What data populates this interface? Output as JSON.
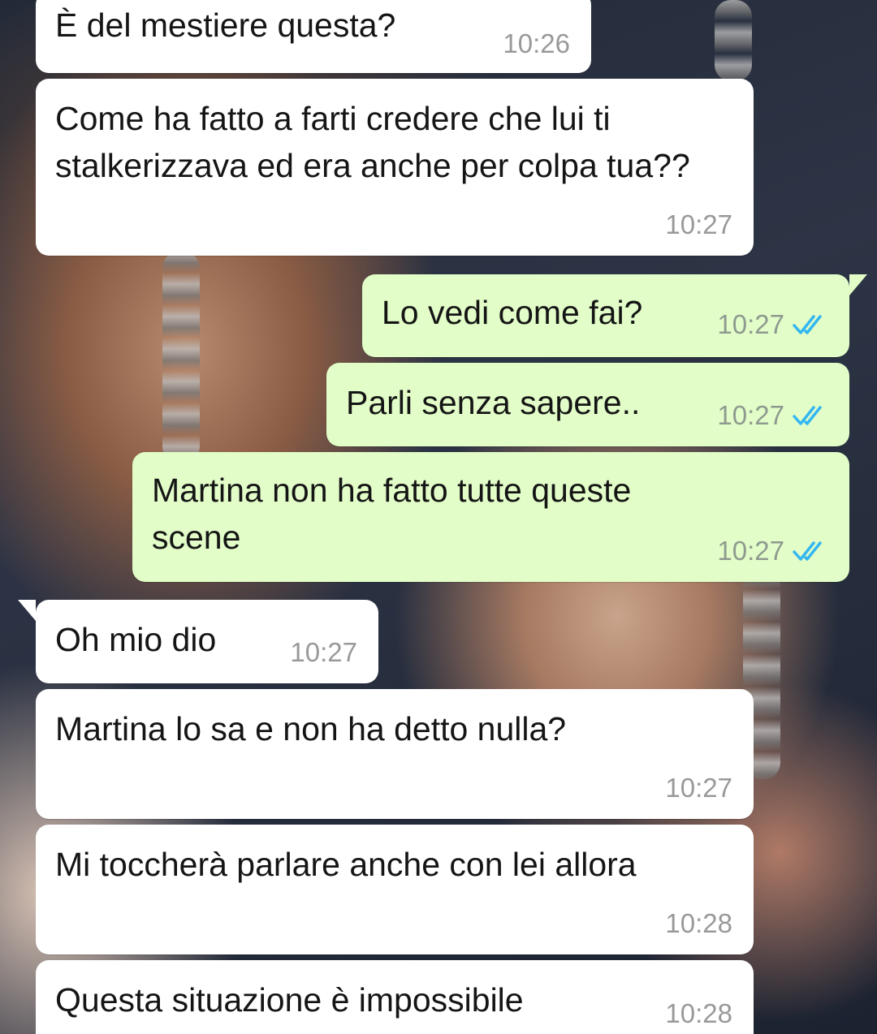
{
  "messages": [
    {
      "direction": "in",
      "text": "È del mestiere questa?",
      "time": "10:26"
    },
    {
      "direction": "in",
      "text": "Come ha fatto a farti credere che lui ti stalkerizzava ed era anche per colpa tua??",
      "time": "10:27"
    },
    {
      "direction": "out",
      "text": "Lo vedi come fai?",
      "time": "10:27",
      "status": "read"
    },
    {
      "direction": "out",
      "text": "Parli senza sapere..",
      "time": "10:27",
      "status": "read"
    },
    {
      "direction": "out",
      "text": "Martina non ha fatto tutte queste scene",
      "time": "10:27",
      "status": "read"
    },
    {
      "direction": "in",
      "text": "Oh mio dio",
      "time": "10:27"
    },
    {
      "direction": "in",
      "text": "Martina lo sa e non ha detto nulla?",
      "time": "10:27"
    },
    {
      "direction": "in",
      "text": "Mi toccherà parlare anche con lei allora",
      "time": "10:28"
    },
    {
      "direction": "in",
      "text": "Questa situazione è impossibile",
      "time": "10:28"
    }
  ],
  "colors": {
    "incoming_bubble": "#ffffff",
    "outgoing_bubble": "#e2fdc8",
    "read_ticks": "#34b7f1"
  },
  "icons": {
    "read_status": "double-check-icon"
  }
}
